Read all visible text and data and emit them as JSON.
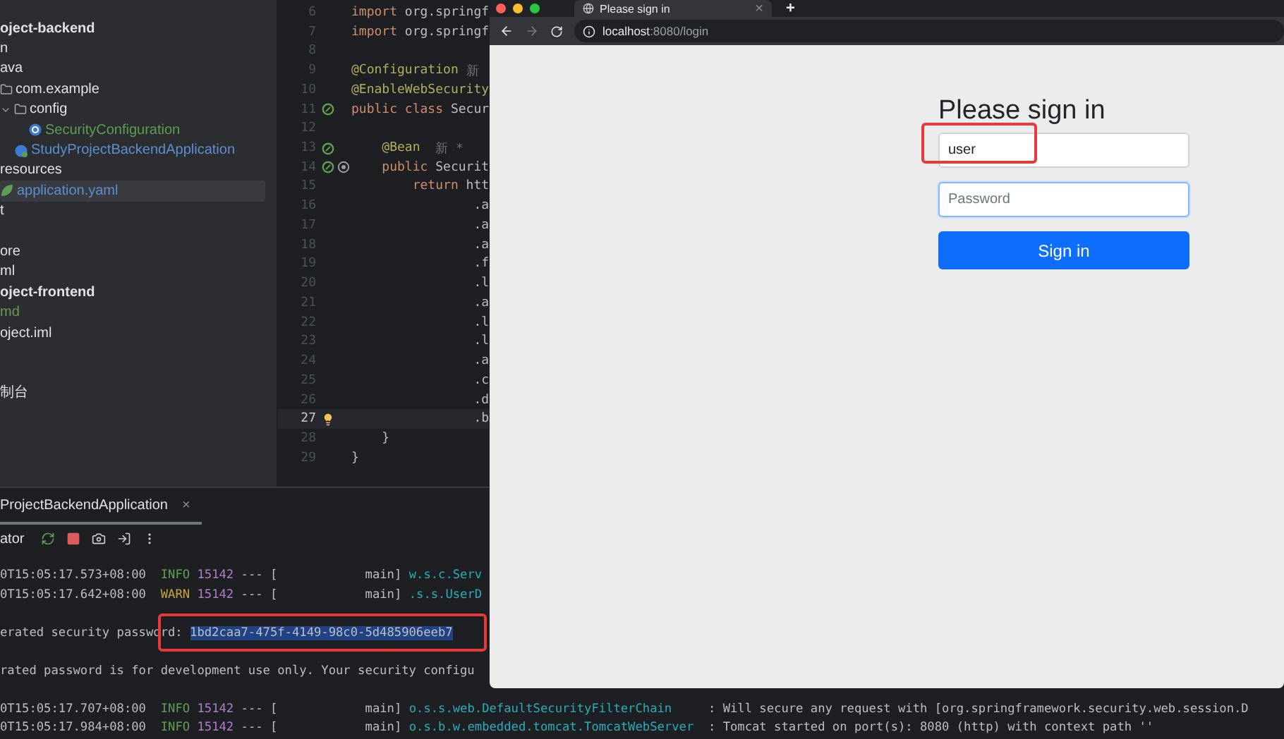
{
  "project_tree": [
    {
      "text": "oject-backend",
      "bold": true,
      "selected": false
    },
    {
      "text": "n",
      "selected": false
    },
    {
      "text": "ava",
      "selected": false
    },
    {
      "text": "com.example",
      "kind": "package",
      "selected": false,
      "children": [
        {
          "text": "config",
          "kind": "package",
          "expanded": true,
          "selected": false,
          "children": [
            {
              "text": "SecurityConfiguration",
              "kind": "class",
              "color": "#5f9e52",
              "selected": false
            }
          ]
        },
        {
          "text": "StudyProjectBackendApplication",
          "kind": "spring",
          "color": "#5c8fcf",
          "selected": false
        }
      ]
    },
    {
      "text": "resources",
      "selected": false
    },
    {
      "text": "application.yaml",
      "kind": "yaml",
      "color": "#5c8fcf",
      "selected": true
    },
    {
      "text": "t",
      "selected": false
    },
    {
      "text": "ore",
      "selected": false,
      "gap_before": true
    },
    {
      "text": "ml",
      "selected": false
    },
    {
      "text": "oject-frontend",
      "bold": true,
      "selected": false
    },
    {
      "text": "md",
      "color": "#6a9a4f",
      "selected": false
    },
    {
      "text": "oject.iml",
      "selected": false
    }
  ],
  "tool_window_label": "制台",
  "editor": {
    "lines": [
      {
        "number": "6",
        "current": false,
        "tokens": [
          {
            "kind": "keyword",
            "text": "import"
          },
          {
            "kind": "plain",
            "text": " org.springf"
          }
        ]
      },
      {
        "number": "7",
        "current": false,
        "tokens": [
          {
            "kind": "keyword",
            "text": "import"
          },
          {
            "kind": "plain",
            "text": " org.springf"
          }
        ]
      },
      {
        "number": "8",
        "current": false
      },
      {
        "number": "9",
        "current": false,
        "tokens": [
          {
            "kind": "annotation",
            "text": "@Configuration"
          },
          {
            "kind": "hint",
            "text": " 新"
          }
        ]
      },
      {
        "number": "10",
        "current": false,
        "tokens": [
          {
            "kind": "annotation",
            "text": "@EnableWebSecurity"
          }
        ]
      },
      {
        "number": "11",
        "current": false,
        "gutter": [
          {
            "kind": "bean"
          }
        ],
        "tokens": [
          {
            "kind": "keyword",
            "text": "public class"
          },
          {
            "kind": "plain",
            "text": " Secur"
          }
        ]
      },
      {
        "number": "12",
        "current": false
      },
      {
        "number": "13",
        "current": false,
        "gutter": [
          {
            "kind": "bean"
          }
        ],
        "tokens": [
          {
            "kind": "annotation",
            "text": "    @Bean"
          },
          {
            "kind": "hint",
            "text": "  新 *"
          }
        ]
      },
      {
        "number": "14",
        "current": false,
        "gutter": [
          {
            "kind": "bean"
          },
          {
            "kind": "target"
          }
        ],
        "tokens": [
          {
            "kind": "keyword",
            "text": "    public"
          },
          {
            "kind": "plain",
            "text": " Securit"
          }
        ]
      },
      {
        "number": "15",
        "current": false,
        "tokens": [
          {
            "kind": "keyword",
            "text": "        return"
          },
          {
            "kind": "plain",
            "text": " htt"
          }
        ]
      },
      {
        "number": "16",
        "current": false,
        "tokens": [
          {
            "kind": "plain",
            "text": "                .a"
          }
        ]
      },
      {
        "number": "17",
        "current": false,
        "tokens": [
          {
            "kind": "plain",
            "text": "                .a"
          }
        ]
      },
      {
        "number": "18",
        "current": false,
        "tokens": [
          {
            "kind": "plain",
            "text": "                .a"
          }
        ]
      },
      {
        "number": "19",
        "current": false,
        "tokens": [
          {
            "kind": "plain",
            "text": "                .f"
          }
        ]
      },
      {
        "number": "20",
        "current": false,
        "tokens": [
          {
            "kind": "plain",
            "text": "                .l"
          }
        ]
      },
      {
        "number": "21",
        "current": false,
        "tokens": [
          {
            "kind": "plain",
            "text": "                .a"
          }
        ]
      },
      {
        "number": "22",
        "current": false,
        "tokens": [
          {
            "kind": "plain",
            "text": "                .l"
          }
        ]
      },
      {
        "number": "23",
        "current": false,
        "tokens": [
          {
            "kind": "plain",
            "text": "                .l"
          }
        ]
      },
      {
        "number": "24",
        "current": false,
        "tokens": [
          {
            "kind": "plain",
            "text": "                .a"
          }
        ]
      },
      {
        "number": "25",
        "current": false,
        "tokens": [
          {
            "kind": "plain",
            "text": "                .c"
          }
        ]
      },
      {
        "number": "26",
        "current": false,
        "tokens": [
          {
            "kind": "plain",
            "text": "                .d"
          }
        ]
      },
      {
        "number": "27",
        "current": true,
        "gutter": [
          {
            "kind": "bulb"
          }
        ],
        "tokens": [
          {
            "kind": "plain",
            "text": "                .b"
          }
        ]
      },
      {
        "number": "28",
        "current": false,
        "tokens": [
          {
            "kind": "plain",
            "text": "    }"
          }
        ]
      },
      {
        "number": "29",
        "current": false,
        "tokens": [
          {
            "kind": "plain",
            "text": "}"
          }
        ]
      }
    ]
  },
  "console": {
    "tab": {
      "title": "ProjectBackendApplication",
      "close": "×"
    },
    "toolbar_label": "ator",
    "lines": [
      {
        "kind": "log",
        "time": "0T15:05:17.573+08:00",
        "level": {
          "text": "INFO",
          "color": "#5f9e52"
        },
        "pid": "15142",
        "sep": "---",
        "thread": "[            main]",
        "logger": "w.s.c.Serv"
      },
      {
        "kind": "log",
        "time": "0T15:05:17.642+08:00",
        "level": {
          "text": "WARN",
          "color": "#c9a33c"
        },
        "pid": "15142",
        "sep": "---",
        "thread": "[            main]",
        "logger": ".s.s.UserD"
      },
      {
        "kind": "secret",
        "text": "erated security password: ",
        "value": "1bd2caa7-475f-4149-98c0-5d485906eeb7"
      },
      {
        "kind": "text",
        "text": "rated password is for development use only. Your security configu"
      },
      {
        "kind": "log",
        "time": "0T15:05:17.707+08:00",
        "level": {
          "text": "INFO",
          "color": "#5f9e52"
        },
        "pid": "15142",
        "sep": "---",
        "thread": "[            main]",
        "logger": "o.s.s.web.DefaultSecurityFilterChain",
        "message": ": Will secure any request with [org.springframework.security.web.session.D"
      },
      {
        "kind": "log",
        "time": "0T15:05:17.984+08:00",
        "level": {
          "text": "INFO",
          "color": "#5f9e52"
        },
        "pid": "15142",
        "sep": "---",
        "thread": "[            main]",
        "logger": "o.s.b.w.embedded.tomcat.TomcatWebServer",
        "message": ": Tomcat started on port(s): 8080 (http) with context path ''"
      }
    ]
  },
  "browser": {
    "tab": {
      "title": "Please sign in",
      "close": "×"
    },
    "new_tab": "+",
    "url_host": "localhost",
    "url_path": ":8080/login",
    "form": {
      "heading": "Please sign in",
      "username": {
        "value": "user"
      },
      "password": {
        "placeholder": "Password",
        "focused": true
      },
      "submit": "Sign in"
    }
  }
}
